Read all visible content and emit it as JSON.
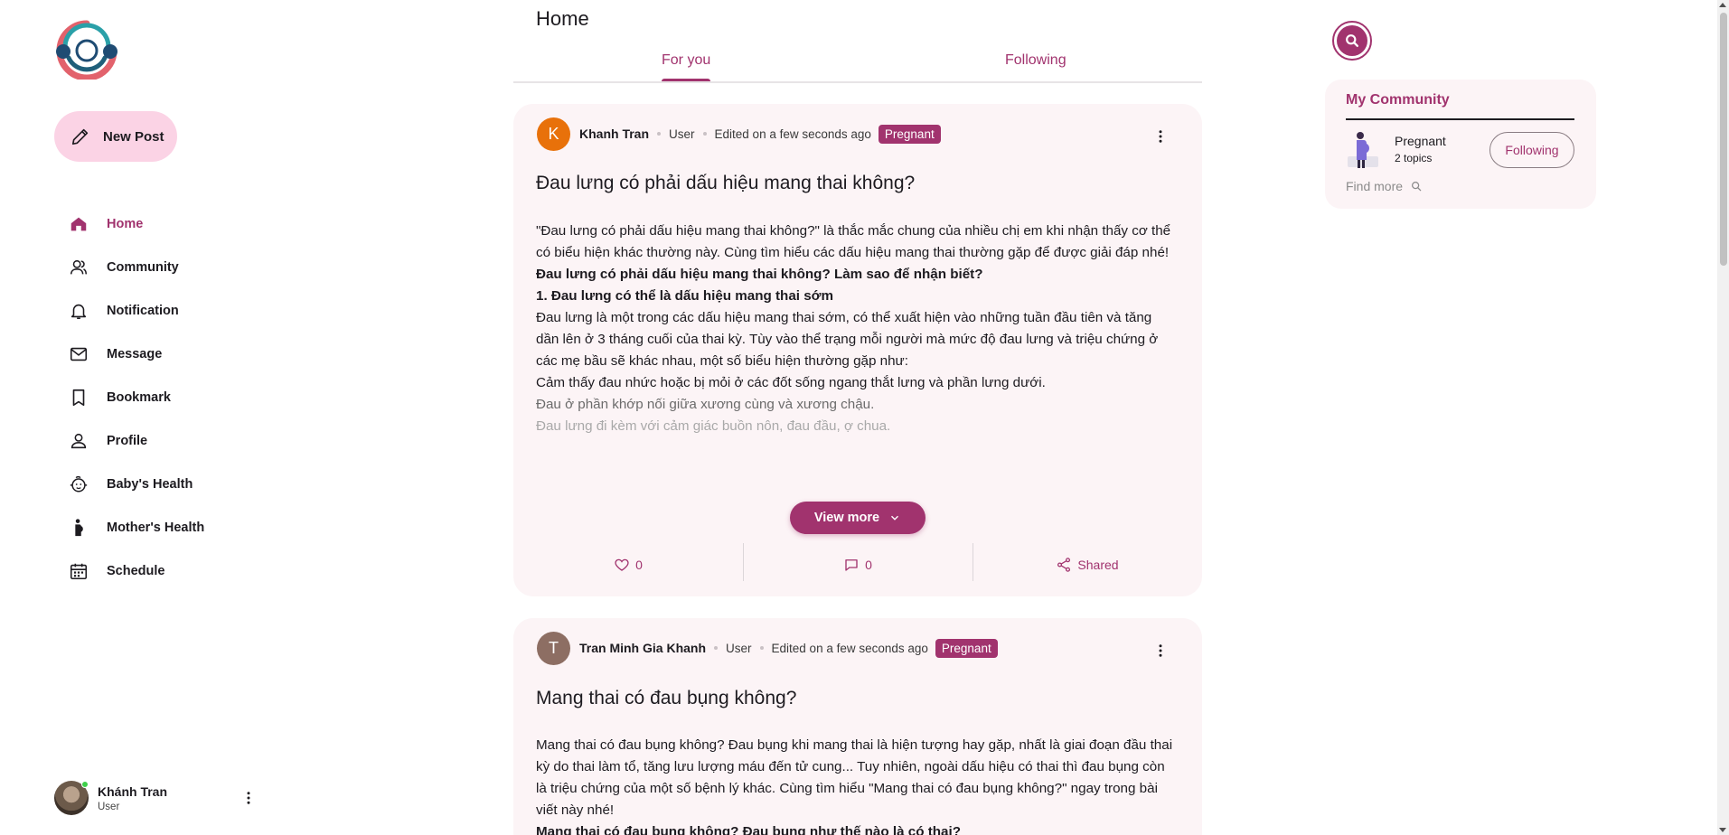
{
  "sidebar": {
    "new_post_label": "New Post",
    "items": [
      {
        "label": "Home",
        "icon": "home-icon",
        "active": true
      },
      {
        "label": "Community",
        "icon": "community-icon"
      },
      {
        "label": "Notification",
        "icon": "bell-icon"
      },
      {
        "label": "Message",
        "icon": "mail-icon"
      },
      {
        "label": "Bookmark",
        "icon": "bookmark-icon"
      },
      {
        "label": "Profile",
        "icon": "person-icon"
      },
      {
        "label": "Baby's Health",
        "icon": "baby-icon"
      },
      {
        "label": "Mother's Health",
        "icon": "pregnant-icon"
      },
      {
        "label": "Schedule",
        "icon": "calendar-icon"
      }
    ],
    "user": {
      "name": "Khánh Tran",
      "role": "User"
    }
  },
  "header": {
    "title": "Home",
    "tabs": [
      {
        "label": "For you",
        "active": true
      },
      {
        "label": "Following"
      }
    ]
  },
  "posts": [
    {
      "avatar_letter": "K",
      "avatar_color": "#e8710a",
      "author": "Khanh Tran",
      "role": "User",
      "edited": "Edited on a few seconds ago",
      "badge": "Pregnant",
      "title": "Đau lưng có phải dấu hiệu mang thai không?",
      "body": [
        "\"Đau lưng có phải dấu hiệu mang thai không?\" là thắc mắc chung của nhiều chị em khi nhận thấy cơ thể có biểu hiện khác thường này. Cùng tìm hiểu các dấu hiệu mang thai thường gặp để được giải đáp nhé!",
        "Đau lưng có phải dấu hiệu mang thai không? Làm sao để nhận biết?",
        "1. Đau lưng có thể là dấu hiệu mang thai sớm",
        "Đau lưng là một trong các dấu hiệu mang thai sớm, có thể xuất hiện vào những tuần đầu tiên và tăng dần lên ở 3 tháng cuối của thai kỳ. Tùy vào thể trạng mỗi người mà mức độ đau lưng và triệu chứng ở các mẹ bầu sẽ khác nhau, một số biểu hiện thường gặp như:",
        "Cảm thấy đau nhức hoặc bị mỏi ở các đốt sống ngang thắt lưng và phần lưng dưới.",
        "Đau ở phần khớp nối giữa xương cùng và xương chậu.",
        "Đau lưng đi kèm với cảm giác buồn nôn, đau đầu, ợ chua."
      ],
      "view_more": "View more",
      "likes": "0",
      "comments": "0",
      "share_label": "Shared"
    },
    {
      "avatar_letter": "T",
      "avatar_color": "#8d6e63",
      "author": "Tran Minh Gia Khanh",
      "role": "User",
      "edited": "Edited on a few seconds ago",
      "badge": "Pregnant",
      "title": "Mang thai có đau bụng không?",
      "body": [
        "Mang thai có đau bụng không? Đau bụng khi mang thai là hiện tượng hay gặp, nhất là giai đoạn đầu thai kỳ do thai làm tổ, tăng lưu lượng máu đến tử cung... Tuy nhiên, ngoài dấu hiệu có thai thì đau bụng còn là triệu chứng của một số bệnh lý khác. Cùng tìm hiểu \"Mang thai có đau bụng không?\" ngay trong bài viết này nhé!",
        "Mang thai có đau bụng không? Đau bụng như thế nào là có thai?"
      ]
    }
  ],
  "community": {
    "title": "My Community",
    "item": {
      "name": "Pregnant",
      "topics": "2 topics",
      "button": "Following"
    },
    "find_more": "Find more"
  },
  "colors": {
    "accent": "#a1336e",
    "accent_light": "#fbd3e5",
    "card_bg": "#fcf4f6"
  }
}
